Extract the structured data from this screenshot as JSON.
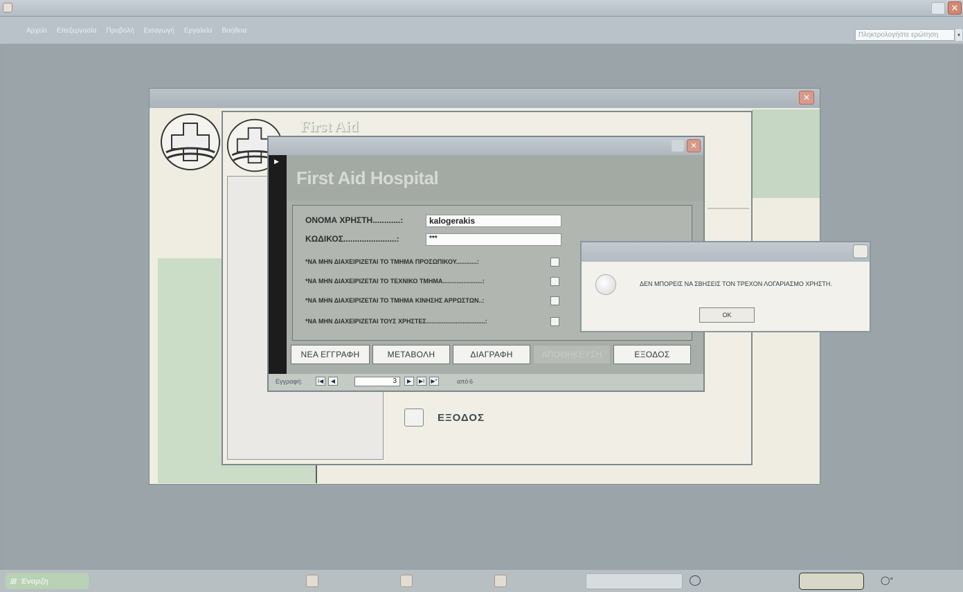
{
  "app": {
    "menu": [
      "Αρχείο",
      "Επεξεργασία",
      "Προβολή",
      "Εισαγωγή",
      "Εργαλεία",
      "Βοήθεια"
    ],
    "help_placeholder": "Πληκτρολογήστε ερώτηση",
    "close_glyph": "✕"
  },
  "switchboard": {
    "brand_partial": "First Aid",
    "exit_label": "ΕΞΟΔΟΣ"
  },
  "form": {
    "heading": "First Aid Hospital",
    "username_label": "ΟΝΟΜΑ ΧΡΗΣΤΗ............:",
    "username_value": "kalogerakis",
    "password_label": "ΚΩΔΙΚΟΣ.......................:",
    "password_value": "***",
    "permissions": [
      {
        "label": "*ΝΑ ΜΗΝ ΔΙΑΧΕΙΡΙΖΕΤΑΙ ΤΟ ΤΜΗΜΑ ΠΡΟΣΩΠΙΚΟΥ............:",
        "checked": false
      },
      {
        "label": "*ΝΑ ΜΗΝ ΔΙΑΧΕΙΡΙΖΕΤΑΙ ΤΟ ΤΕΧΝΙΚΟ ΤΜΗΜΑ.......................:",
        "checked": false
      },
      {
        "label": "*ΝΑ ΜΗΝ ΔΙΑΧΕΙΡΙΖΕΤΑΙ ΤΟ ΤΜΗΜΑ ΚΙΝΗΣΗΣ ΑΡΡΩΣΤΩΝ..:",
        "checked": false
      },
      {
        "label": "*ΝΑ ΜΗΝ ΔΙΑΧΕΙΡΙΖΕΤΑΙ ΤΟΥΣ ΧΡΗΣΤΕΣ..................................:",
        "checked": false
      }
    ],
    "buttons": {
      "new": "ΝΕΑ ΕΓΓΡΑΦΗ",
      "edit": "ΜΕΤΑΒΟΛΗ",
      "delete": "ΔΙΑΓΡΑΦΗ",
      "save": "ΑΠΟΘΗΚΕΥΣΗ",
      "exit": "ΕΞΟΔΟΣ"
    },
    "record_nav": {
      "label": "Εγγραφή:",
      "current": "3",
      "of": "από",
      "total": "6"
    }
  },
  "message_box": {
    "text": "ΔΕΝ ΜΠΟΡΕΙΣ ΝΑ ΣΒΗΣΕΙΣ ΤΟΝ ΤΡΕΧΟΝ ΛΟΓΑΡΙΑΣΜΟ ΧΡΗΣΤΗ.",
    "ok_label": "OK"
  },
  "taskbar": {
    "start_label": "Έναρξη"
  }
}
